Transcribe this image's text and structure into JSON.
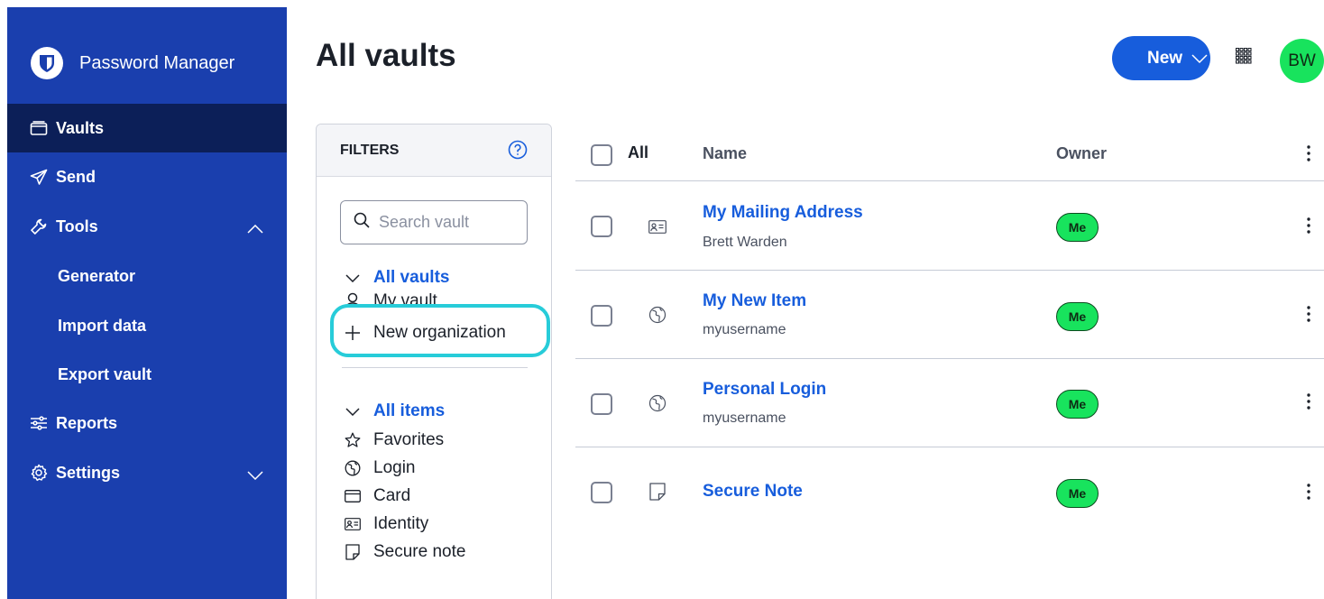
{
  "sidebar": {
    "brand": "Password Manager",
    "logo_icon": "bitwarden-shield-icon",
    "items": [
      {
        "label": "Vaults",
        "icon": "vault-icon",
        "active": true
      },
      {
        "label": "Send",
        "icon": "send-icon"
      },
      {
        "label": "Tools",
        "icon": "wrench-icon",
        "expanded": true
      },
      {
        "label": "Generator"
      },
      {
        "label": "Import data"
      },
      {
        "label": "Export vault"
      },
      {
        "label": "Reports",
        "icon": "sliders-icon"
      },
      {
        "label": "Settings",
        "icon": "gear-icon",
        "expanded": false
      }
    ]
  },
  "header": {
    "title": "All vaults",
    "new_label": "New",
    "avatar_initials": "BW"
  },
  "filters": {
    "title": "FILTERS",
    "search_placeholder": "Search vault",
    "vaults": {
      "heading": "All vaults",
      "items": [
        "My vault",
        "New organization"
      ]
    },
    "types": {
      "heading": "All items",
      "items": [
        "Favorites",
        "Login",
        "Card",
        "Identity",
        "Secure note"
      ]
    }
  },
  "table": {
    "headers": {
      "select_all": "All",
      "name": "Name",
      "owner": "Owner"
    },
    "rows": [
      {
        "name": "My Mailing Address",
        "subtitle": "Brett Warden",
        "type_icon": "identity-icon",
        "owner": "Me"
      },
      {
        "name": "My New Item",
        "subtitle": "myusername",
        "type_icon": "globe-icon",
        "owner": "Me"
      },
      {
        "name": "Personal Login",
        "subtitle": "myusername",
        "type_icon": "globe-icon",
        "owner": "Me"
      },
      {
        "name": "Secure Note",
        "subtitle": "",
        "type_icon": "note-icon",
        "owner": "Me"
      }
    ]
  },
  "colors": {
    "sidebar_bg": "#1a3fae",
    "sidebar_active": "#0c1f58",
    "primary": "#175ddc",
    "owner_badge": "#18e35d",
    "highlight": "#27ccd9"
  }
}
